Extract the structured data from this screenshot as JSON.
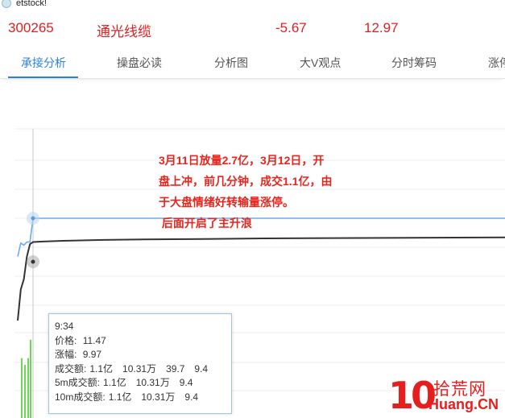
{
  "app": {
    "title": "etstock!",
    "icon": "app-logo-icon"
  },
  "stock": {
    "code": "300265",
    "name": "通光线缆",
    "change": "-5.67",
    "price": "12.97",
    "color": "#e02020"
  },
  "tabs": [
    {
      "label": "承接分析",
      "active": true
    },
    {
      "label": "操盘必读",
      "active": false
    },
    {
      "label": "分析图",
      "active": false
    },
    {
      "label": "大V观点",
      "active": false
    },
    {
      "label": "分时筹码",
      "active": false
    },
    {
      "label": "涨停",
      "active": false
    }
  ],
  "accent_color": "#2b83d8",
  "annotation": {
    "lines": [
      "3月11日放量2.7亿，3月12日，开",
      "盘上冲，前几分钟，成交1.1亿，由",
      "于大盘情绪好转输量涨停。",
      " 后面开启了主升浪"
    ],
    "color": "#e8241c"
  },
  "tooltip": {
    "time": "9:34",
    "price_label": "价格:",
    "price": "11.47",
    "pct_label": "涨幅:",
    "pct": "9.97",
    "vol_label": "成交额:",
    "vol": [
      "1.1亿",
      "10.31万",
      "39.7",
      "9.4"
    ],
    "vol5_label": "5m成交额:",
    "vol5": [
      "1.1亿",
      "10.31万",
      "9.4"
    ],
    "vol10_label": "10m成交额:",
    "vol10": [
      "1.1亿",
      "10.31万",
      "9.4"
    ]
  },
  "chart_data": {
    "type": "line",
    "series": [
      {
        "color": "#6aaaf0",
        "x": [
          0,
          1,
          2,
          3,
          4,
          5,
          60,
          240
        ],
        "y": [
          0.62,
          0.75,
          0.73,
          0.76,
          0.76,
          0.99,
          0.99,
          0.99
        ]
      },
      {
        "color": "#333333",
        "x": [
          0,
          1,
          2,
          3,
          4,
          5,
          10,
          20,
          40,
          60,
          90,
          120,
          180,
          240
        ],
        "y": [
          0.0,
          0.3,
          0.4,
          0.62,
          0.74,
          0.76,
          0.765,
          0.772,
          0.78,
          0.785,
          0.79,
          0.795,
          0.8,
          0.805
        ]
      }
    ],
    "volume": {
      "color": "#6bd65a",
      "values": [
        0.62,
        0.55,
        0.62,
        0.81
      ]
    }
  },
  "watermark": {
    "number": "10",
    "cn": "拾荒网",
    "en": "Huang.CN",
    "color": "#e61e1e"
  }
}
